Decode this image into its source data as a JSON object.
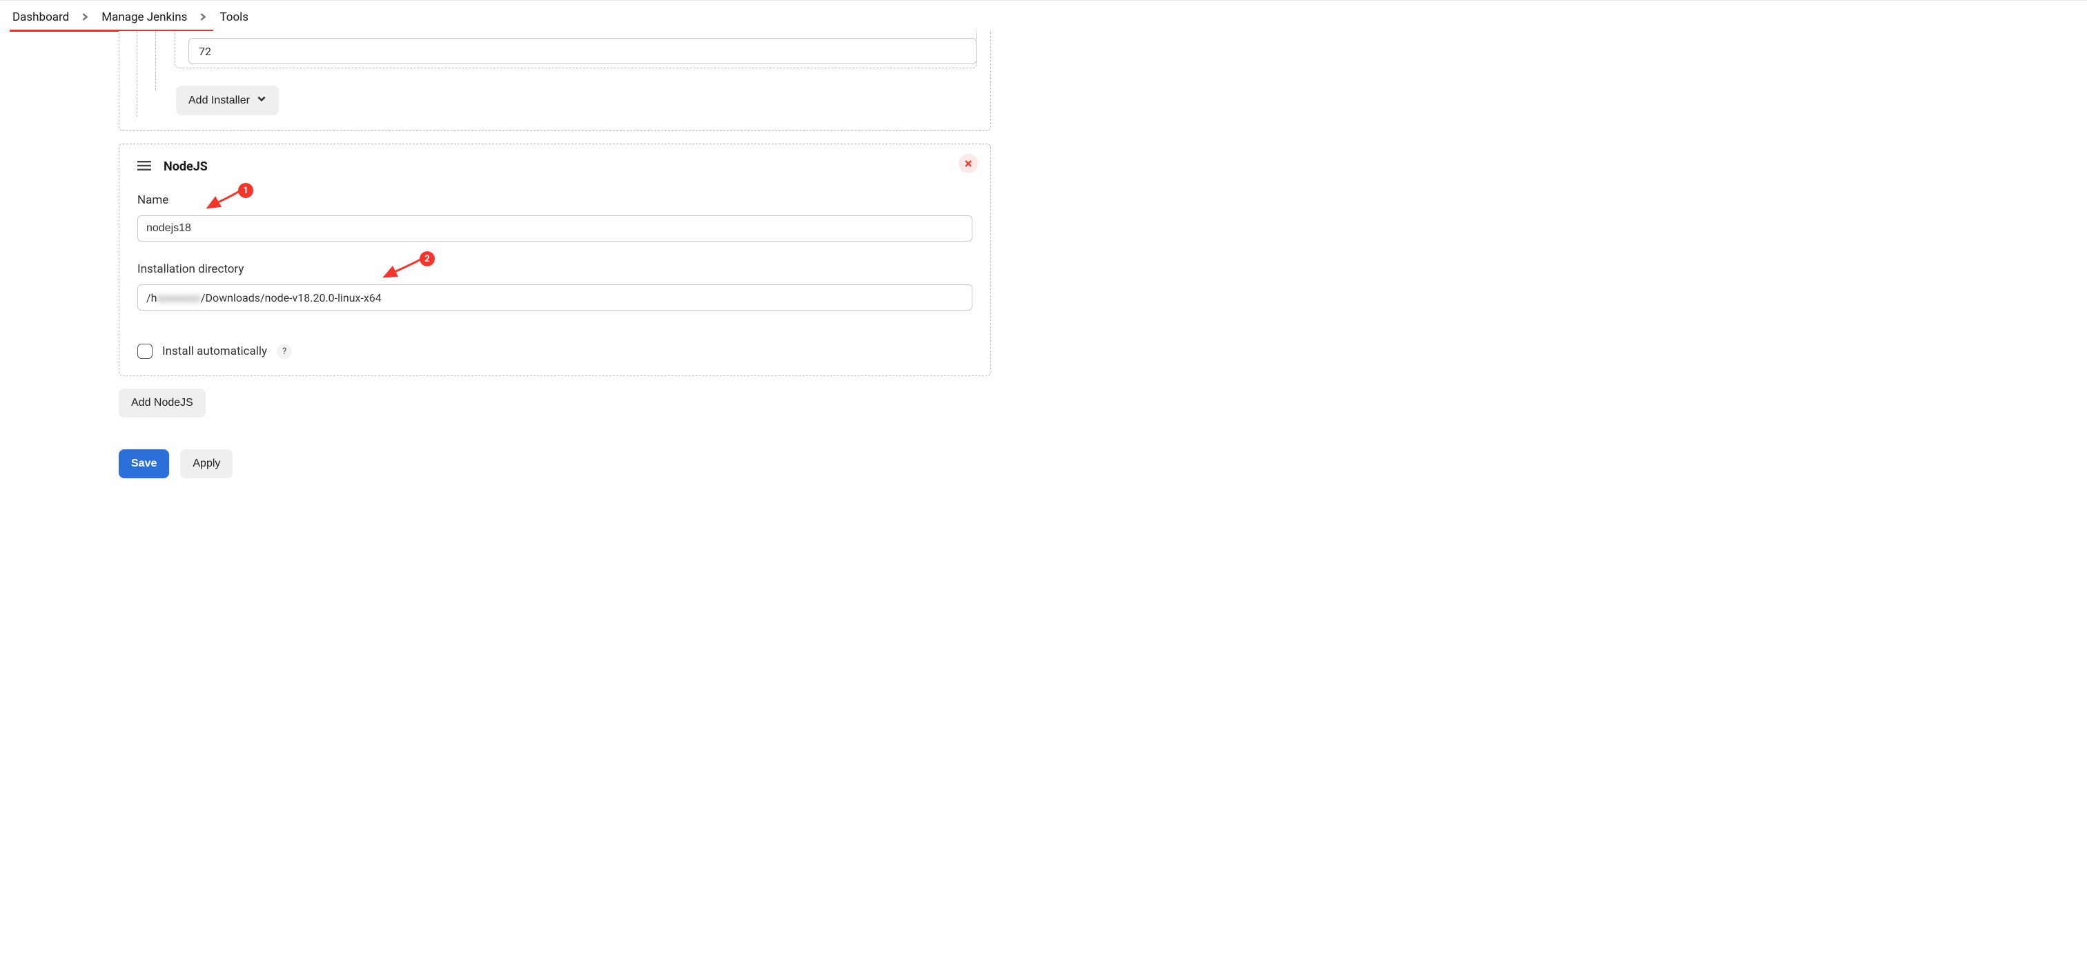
{
  "breadcrumbs": {
    "items": [
      {
        "label": "Dashboard"
      },
      {
        "label": "Manage Jenkins"
      },
      {
        "label": "Tools"
      }
    ]
  },
  "partial": {
    "stub_value": "72",
    "add_installer": "Add Installer"
  },
  "nodejs": {
    "section_title": "NodeJS",
    "name_label": "Name",
    "name_value": "nodejs18",
    "dir_label": "Installation directory",
    "dir_prefix": "/h",
    "dir_masked": "xxxxxxxx",
    "dir_suffix": "/Downloads/node-v18.20.0-linux-x64",
    "install_auto_label": "Install automatically",
    "help_char": "?"
  },
  "add_nodejs": "Add NodeJS",
  "footer": {
    "save": "Save",
    "apply": "Apply"
  },
  "annotations": {
    "m1": "1",
    "m2": "2"
  }
}
